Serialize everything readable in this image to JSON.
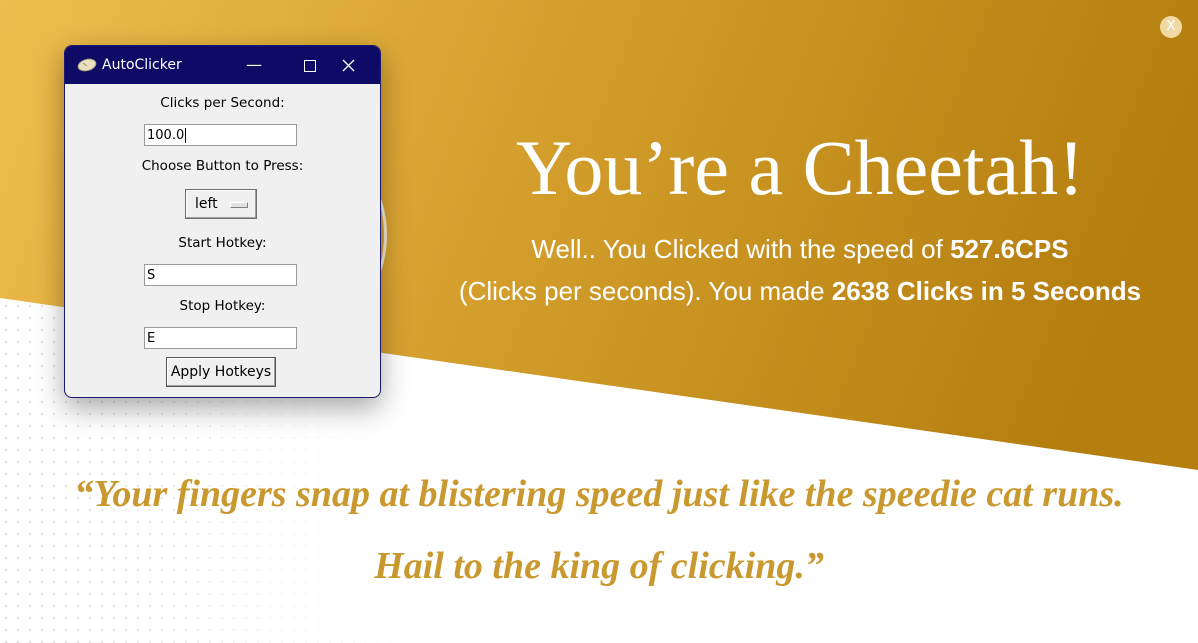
{
  "colors": {
    "gold_light": "#efbd4e",
    "gold_dark": "#b57f10",
    "quote_gold": "#c9992f",
    "titlebar_navy": "#0d0b66"
  },
  "overlay": {
    "close_label": "X",
    "headline": "You’re a Cheetah!",
    "line1_prefix": "Well.. You Clicked with the speed of ",
    "cps_value": "527.6CPS",
    "line2_prefix": "(Clicks per seconds). You made ",
    "clicks_summary": "2638 Clicks in 5 Seconds",
    "quote_line1": "“Your fingers snap at blistering speed just like the speedie cat runs.",
    "quote_line2": "Hail to the king of clicking.”"
  },
  "window": {
    "title": "AutoClicker",
    "app_icon": "mouse-icon",
    "controls": {
      "minimize": "minimize-icon",
      "maximize": "maximize-icon",
      "close": "close-icon"
    },
    "cps_label": "Clicks per Second:",
    "cps_value": "100.0",
    "button_label": "Choose Button to Press:",
    "button_selected": "left",
    "start_label": "Start Hotkey:",
    "start_value": "S",
    "stop_label": "Stop Hotkey:",
    "stop_value": "E",
    "apply_label": "Apply Hotkeys"
  }
}
